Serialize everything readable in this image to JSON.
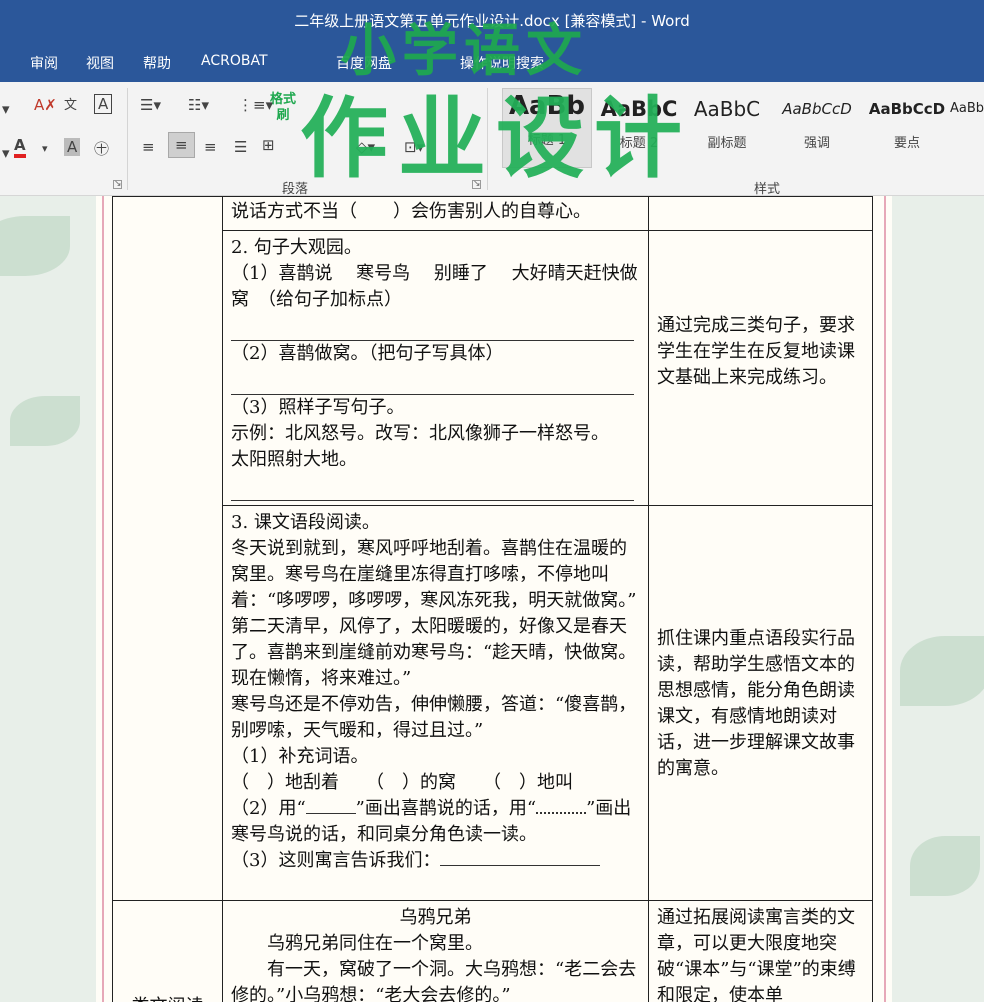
{
  "window": {
    "title": "二年级上册语文第五单元作业设计.docx [兼容模式]  -  Word"
  },
  "menu": {
    "review": "审阅",
    "view": "视图",
    "help": "帮助",
    "acrobat": "ACROBAT",
    "baidu": "百度网盘",
    "tell": "操作说明搜索"
  },
  "ribbon": {
    "paragraph_group": "段落",
    "styles_group": "样式",
    "styles": [
      {
        "sample": "AaBb",
        "name": "标题 1"
      },
      {
        "sample": "AaBbC",
        "name": "标题 2"
      },
      {
        "sample": "AaBbC",
        "name": "副标题"
      },
      {
        "sample": "AaBbCcD",
        "name": "强调"
      },
      {
        "sample": "AaBbCcD",
        "name": "要点"
      },
      {
        "sample": "AaBb",
        "name": ""
      }
    ]
  },
  "watermark": {
    "line1": "小学语文",
    "line2": "作业设计",
    "vertical": "格式刷"
  },
  "document": {
    "row1": {
      "text": "说话方式不当（　　）会伤害别人的自尊心。"
    },
    "row2": {
      "heading": "2. 句子大观园。",
      "q1": "（1）喜鹊说　 寒号鸟　 别睡了　 大好晴天赶快做窝　（给句子加标点）",
      "q2": "（2）喜鹊做窝。（把句子写具体）",
      "q3": "（3）照样子写句子。",
      "example": "示例：北风怒号。改写：北风像狮子一样怒号。",
      "prompt": "太阳照射大地。",
      "note": "通过完成三类句子，要求学生在学生在反复地读课文基础上来完成练习。"
    },
    "row3": {
      "heading": "3. 课文语段阅读。",
      "p1": "冬天说到就到，寒风呼呼地刮着。喜鹊住在温暖的窝里。寒号鸟在崖缝里冻得直打哆嗦，不停地叫着：“哆啰啰，哆啰啰，寒风冻死我，明天就做窝。”",
      "p2": "第二天清早，风停了，太阳暖暖的，好像又是春天了。喜鹊来到崖缝前劝寒号鸟：“趁天晴，快做窝。现在懒惰，将来难过。”",
      "p3": "寒号鸟还是不停劝告，伸伸懒腰，答道：“傻喜鹊，别啰嗦，天气暖和，得过且过。”",
      "q1": "（1）补充词语。",
      "q1_items": "（　）地刮着　　（　）的窝　　（　）地叫",
      "q2_a": "（2）用“",
      "q2_b": "”画出喜鹊说的话，用“",
      "q2_c": "”画出寒号鸟说的话，和同桌分角色读一读。",
      "q3": "（3）这则寓言告诉我们：",
      "note": "抓住课内重点语段实行品读，帮助学生感悟文本的思想感情，能分角色朗读课文，有感情地朗读对话，进一步理解课文故事的寓意。"
    },
    "row4": {
      "category": "类文阅读",
      "title": "乌鸦兄弟",
      "p1": "乌鸦兄弟同住在一个窝里。",
      "p2": "有一天，窝破了一个洞。大乌鸦想：“老二会去修的。”小乌鸦想：“老大会去修的。”",
      "note": "通过拓展阅读寓言类的文章，可以更大限度地突破“课本”与“课堂”的束缚和限定，使本单"
    }
  }
}
